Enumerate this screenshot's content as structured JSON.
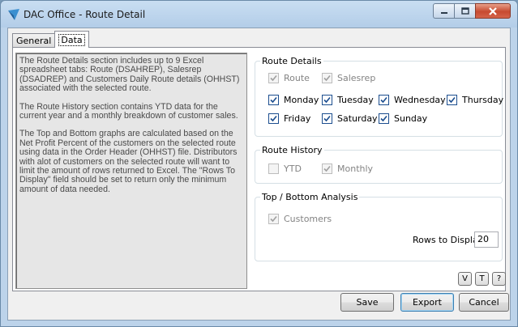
{
  "window": {
    "title": "DAC Office - Route Detail"
  },
  "tabs": [
    {
      "label": "General"
    },
    {
      "label": "Data"
    }
  ],
  "description": {
    "paragraphs": [
      "The Route Details section includes up to 9 Excel spreadsheet tabs: Route (DSAHREP), Salesrep (DSADREP) and Customers Daily Route details (OHHST) associated with the selected route.",
      "The Route History section contains YTD data for the current year and a monthly breakdown of customer sales.",
      "The Top and Bottom graphs are calculated based on the Net Profit Percent of the customers on the selected route using data in the Order Header (OHHST) file.  Distributors with alot of customers on the selected route will want to limit the amount of rows returned to Excel.  The \"Rows To Display\" field should be set to return only the minimum amount of data needed."
    ]
  },
  "route_details": {
    "label": "Route Details",
    "route": "Route",
    "salesrep": "Salesrep",
    "monday": "Monday",
    "tuesday": "Tuesday",
    "wednesday": "Wednesday",
    "thursday": "Thursday",
    "friday": "Friday",
    "saturday": "Saturday",
    "sunday": "Sunday"
  },
  "route_history": {
    "label": "Route History",
    "ytd": "YTD",
    "monthly": "Monthly"
  },
  "top_bottom": {
    "label": "Top / Bottom Analysis",
    "customers": "Customers",
    "rows_label": "Rows to Display",
    "rows_value": "20"
  },
  "small_buttons": {
    "v": "V",
    "t": "T",
    "help": "?"
  },
  "buttons": {
    "save": "Save",
    "export": "Export",
    "cancel": "Cancel"
  },
  "colors": {
    "accent": "#1c4e8f",
    "title_bg": "#bcd3ea",
    "close": "#c74a30"
  }
}
